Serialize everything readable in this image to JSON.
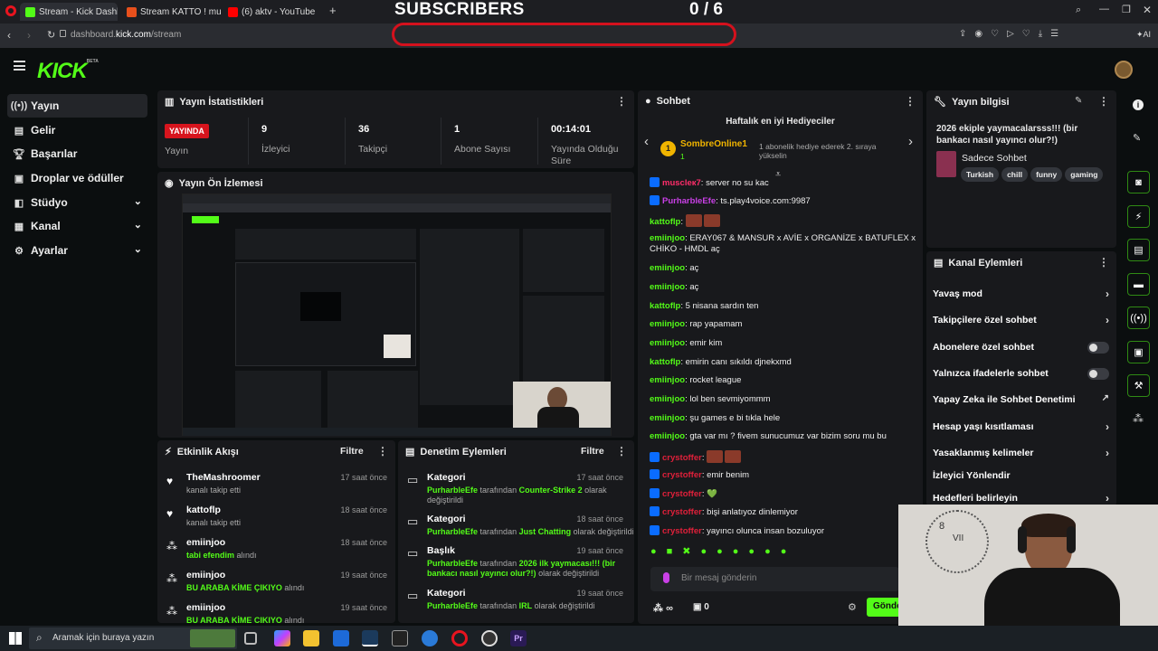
{
  "browser": {
    "tabs": [
      {
        "label": "Stream - Kick Dashboard",
        "active": true
      },
      {
        "label": "Stream KATTO ! music | Li"
      },
      {
        "label": "(6) aktv - YouTube"
      }
    ],
    "url_prefix": "dashboard.",
    "url_domain": "kick.com",
    "url_path": "/stream",
    "ai_label": "AI"
  },
  "overlay": {
    "title": "SUBSCRIBERS",
    "count": "0  / 6"
  },
  "kick": {
    "logo": "KICK",
    "logo_sup": "BETA"
  },
  "sidebar": {
    "items": [
      {
        "label": "Yayın",
        "icon": "broadcast-icon"
      },
      {
        "label": "Gelir",
        "icon": "money-icon"
      },
      {
        "label": "Başarılar",
        "icon": "trophy-icon"
      },
      {
        "label": "Droplar ve ödüller",
        "icon": "gift-icon"
      },
      {
        "label": "Stüdyo",
        "icon": "studio-icon"
      },
      {
        "label": "Kanal",
        "icon": "channel-icon"
      },
      {
        "label": "Ayarlar",
        "icon": "gear-icon"
      }
    ]
  },
  "stats": {
    "title": "Yayın İstatistikleri",
    "status": "YAYINDA",
    "status_label": "Yayın",
    "viewers": "9",
    "viewers_label": "İzleyici",
    "followers": "36",
    "followers_label": "Takipçi",
    "subs": "1",
    "subs_label": "Abone Sayısı",
    "uptime": "00:14:01",
    "uptime_label": "Yayında Olduğu Süre"
  },
  "preview": {
    "title": "Yayın Ön İzlemesi"
  },
  "activity": {
    "title": "Etkinlik Akışı",
    "filter": "Filtre",
    "items": [
      {
        "name": "TheMashroomer",
        "desc": "kanalı takip etti",
        "hl": "",
        "time": "17 saat önce"
      },
      {
        "name": "kattoflp",
        "desc": "kanalı takip etti",
        "hl": "",
        "time": "18 saat önce"
      },
      {
        "name": "emiinjoo",
        "desc": "alındı",
        "hl": "tabi efendim",
        "time": "18 saat önce"
      },
      {
        "name": "emiinjoo",
        "desc": "alındı",
        "hl": "BU ARABA KİME ÇIKIYO",
        "time": "19 saat önce"
      },
      {
        "name": "emiinjoo",
        "desc": "alındı",
        "hl": "BU ARABA KİME ÇIKIYO",
        "time": "19 saat önce"
      }
    ]
  },
  "moderation": {
    "title": "Denetim Eylemleri",
    "filter": "Filtre",
    "items": [
      {
        "name": "Kategori",
        "user": "PurharbleEfe",
        "mid": "tarafından",
        "hl": "Counter-Strike 2",
        "end": "olarak değiştirildi",
        "time": "17 saat önce"
      },
      {
        "name": "Kategori",
        "user": "PurharbleEfe",
        "mid": "tarafından",
        "hl": "Just Chatting",
        "end": "olarak değiştirildi",
        "time": "18 saat önce"
      },
      {
        "name": "Başlık",
        "user": "PurharbleEfe",
        "mid": "tarafından",
        "hl": "2026 ilk yaymacası!!! (bir bankacı nasıl yayıncı olur?!)",
        "end": "olarak değiştirildi",
        "time": "19 saat önce"
      },
      {
        "name": "Kategori",
        "user": "PurharbleEfe",
        "mid": "tarafından",
        "hl": "IRL",
        "end": "olarak değiştirildi",
        "time": "19 saat önce"
      }
    ]
  },
  "chat": {
    "title": "Sohbet",
    "gifters_title": "Haftalık en iyi Hediyeciler",
    "top_gifter": "SombreOnline1",
    "top_gifter_count": "1",
    "gifter_note": "1 abonelik hediye ederek 2. sıraya yükselin",
    "messages": [
      {
        "user": "muscleк7",
        "text": "server no su kac",
        "style": "u4",
        "badge": true
      },
      {
        "user": "PurharbleEfe",
        "text": "ts.play4voice.com:9987",
        "style": "u2",
        "badge": true
      },
      {
        "user": "kattoflp",
        "text": "",
        "style": "u",
        "badge": false,
        "emote": true
      },
      {
        "user": "emiinjoo",
        "text": "ERAY067 & MANSUR x AVİE x ORGANİZE x BATUFLEX x",
        "style": "u",
        "badge": false
      },
      {
        "user": "",
        "text": "CHİKO - HMDL aç",
        "style": "u",
        "badge": false
      },
      {
        "user": "emiinjoo",
        "text": "aç",
        "style": "u",
        "badge": false
      },
      {
        "user": "emiinjoo",
        "text": "aç",
        "style": "u",
        "badge": false
      },
      {
        "user": "kattoflp",
        "text": "5 nisana sardın ten",
        "style": "u",
        "badge": false
      },
      {
        "user": "emiinjoo",
        "text": "rap yapamam",
        "style": "u",
        "badge": false
      },
      {
        "user": "emiinjoo",
        "text": "emir kim",
        "style": "u",
        "badge": false
      },
      {
        "user": "kattoflp",
        "text": "emirin canı sıkıldı djnekxmd",
        "style": "u",
        "badge": false
      },
      {
        "user": "emiinjoo",
        "text": "rocket league",
        "style": "u",
        "badge": false
      },
      {
        "user": "emiinjoo",
        "text": "lol ben sevmiyommm",
        "style": "u",
        "badge": false
      },
      {
        "user": "emiinjoo",
        "text": "şu games e bi tıkla hele",
        "style": "u",
        "badge": false
      },
      {
        "user": "emiinjoo",
        "text": "gta var mı ? fivem sunucumuz var bizim soru mu bu",
        "style": "u",
        "badge": false
      },
      {
        "user": "crystoffer",
        "text": "",
        "style": "u3",
        "badge": true,
        "emote": true
      },
      {
        "user": "crystoffer",
        "text": "emir benim",
        "style": "u3",
        "badge": true
      },
      {
        "user": "crystoffer",
        "text": "💚",
        "style": "u3",
        "badge": true
      },
      {
        "user": "crystoffer",
        "text": "bişi anlatıyoz dinlemiyor",
        "style": "u3",
        "badge": true
      },
      {
        "user": "crystoffer",
        "text": "yayıncı olunca insan bozuluyor",
        "style": "u3",
        "badge": true
      }
    ],
    "input_placeholder": "Bir mesaj gönderin",
    "infinite": "∞",
    "points": "0",
    "send": "Gönder"
  },
  "streaminfo": {
    "title": "Yayın bilgisi",
    "stream_title": "2026 ekiple yaymacalarsss!!! (bir bankacı nasıl yayıncı olur?!)",
    "category": "Sadece Sohbet",
    "tags": [
      "Turkish",
      "chill",
      "funny",
      "gaming"
    ]
  },
  "channel_actions": {
    "title": "Kanal Eylemleri",
    "items": [
      {
        "label": "Yavaş mod",
        "kind": "arrow"
      },
      {
        "label": "Takipçilere özel sohbet",
        "kind": "arrow"
      },
      {
        "label": "Abonelere özel sohbet",
        "kind": "toggle"
      },
      {
        "label": "Yalnızca ifadelerle sohbet",
        "kind": "toggle"
      },
      {
        "label": "Yapay Zeka ile Sohbet Denetimi",
        "kind": "external"
      },
      {
        "label": "Hesap yaşı kısıtlaması",
        "kind": "arrow"
      },
      {
        "label": "Yasaklanmış kelimeler",
        "kind": "arrow"
      },
      {
        "label": "İzleyici Yönlendir",
        "kind": "none"
      },
      {
        "label": "Hedefleri belirleyin",
        "kind": "arrow"
      }
    ]
  },
  "taskbar": {
    "search_placeholder": "Aramak için buraya yazın"
  },
  "colors": {
    "accent": "#53fc18",
    "live": "#d7141d",
    "panel": "#18191c",
    "bg": "#0b0e0f"
  }
}
